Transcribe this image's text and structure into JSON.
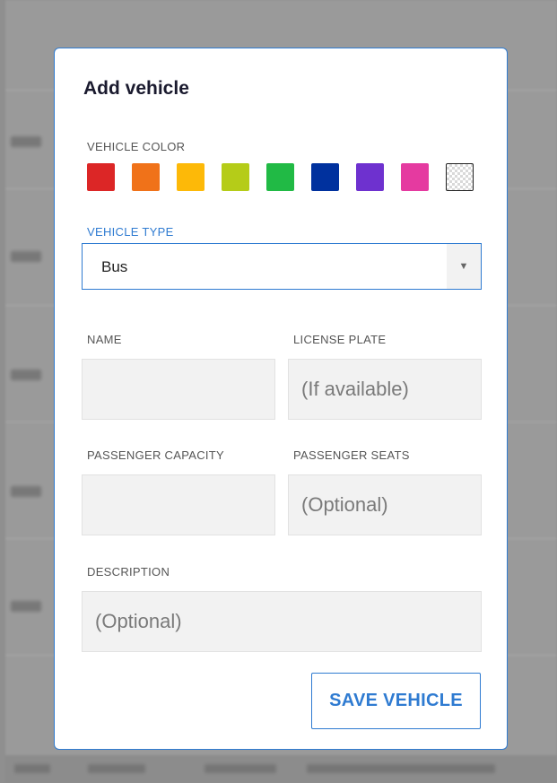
{
  "modal": {
    "title": "Add vehicle",
    "vehicle_color_label": "VEHICLE COLOR",
    "colors": [
      "#dc2626",
      "#f07219",
      "#fdb908",
      "#b5cc18",
      "#21ba45",
      "#00319e",
      "#6e31cf",
      "#e53aa0",
      "transparent"
    ],
    "vehicle_type_label": "VEHICLE TYPE",
    "vehicle_type_value": "Bus",
    "name_label": "NAME",
    "license_plate_label": "LICENSE PLATE",
    "license_plate_placeholder": "(If available)",
    "passenger_capacity_label": "PASSENGER CAPACITY",
    "passenger_seats_label": "PASSENGER SEATS",
    "passenger_seats_placeholder": "(Optional)",
    "description_label": "DESCRIPTION",
    "description_placeholder": "(Optional)",
    "save_label": "SAVE VEHICLE",
    "accent_color": "#2f7bd1"
  }
}
